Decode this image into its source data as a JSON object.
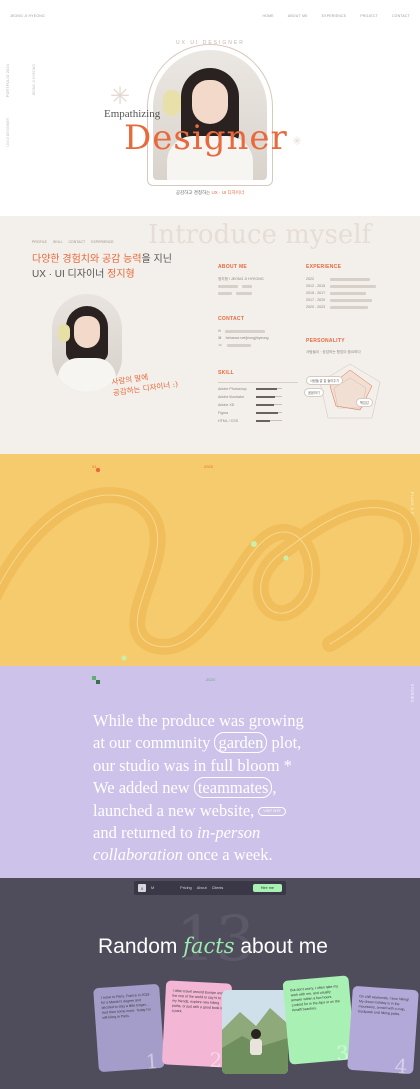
{
  "nav": {
    "brand": "JEONG JI HYEONG",
    "items": [
      "HOME",
      "ABOUT ME",
      "EXPERIENCE",
      "PROJECT",
      "CONTACT"
    ]
  },
  "hero": {
    "side_label_top": "PORTFOLIO 2024",
    "side_label_bottom": "UX/UI DESIGNER",
    "side_label_right": "JEONG JI HYEONG",
    "curve_text": "UX UI DESIGNER",
    "empath": "Empathizing",
    "designer": "Designer",
    "subtitle_prefix": "공감하고 경청하는",
    "subtitle_highlight": "UX · UI 디자이너"
  },
  "about": {
    "ghost": "Introduce myself",
    "crumbs": [
      "PROFILE",
      "SKILL",
      "CONTACT",
      "EXPERIENCE"
    ],
    "headline_1a": "다양한 경험치와 공감 능력",
    "headline_1b": "을 지닌",
    "headline_2a": "UX · UI 디자이너 ",
    "headline_2b": "정지형",
    "quote_line1": "사람의 말에",
    "quote_line2": "공감하는 디자이너 :)",
    "about_title": "ABOUT ME",
    "about_name": "정지형 / JEONG JI HYEONG",
    "contact_title": "CONTACT",
    "contact_email": "behance.net/jeongjihyeong",
    "skill_title": "SKILL",
    "skills": [
      {
        "name": "Adobe Photoshop",
        "level": 0.82
      },
      {
        "name": "Adobe Illustrator",
        "level": 0.74
      },
      {
        "name": "Adobe XD",
        "level": 0.7
      },
      {
        "name": "Figma",
        "level": 0.86
      },
      {
        "name": "HTML / CSS",
        "level": 0.55
      }
    ],
    "experience_title": "EXPERIENCE",
    "experience_years": [
      "2022",
      "2012 - 2015",
      "2015 - 2017",
      "2017 - 2020",
      "2020 - 2023"
    ],
    "personality_title": "PERSONALITY",
    "personality_sub": "사람들이 · 공감하는 협업이 중요하다",
    "personality_tags": [
      "사람들 말 잘 들어주기",
      "꼼꼼하기",
      "책임감"
    ]
  },
  "yellow": {
    "label_left": "01",
    "label_right": "2023",
    "side_label": "PLANS & STORIES"
  },
  "purple": {
    "year": "2023",
    "side_label": "STORIES",
    "line1": "While the produce was growing",
    "line2a": "at our community ",
    "pill_garden": "garden",
    "line2b": " plot,",
    "line3": "our studio was in full bloom *",
    "line4a": "We added new ",
    "pill_team": "teammates",
    "line4b": ",",
    "line5a": "launched a new website, ",
    "mini_pill": "VISIT SITE",
    "line6a": "and returned to ",
    "line6b": "in-person",
    "line7a": "collaboration",
    "line7b": " once a week."
  },
  "dark": {
    "nav_logo": "X",
    "nav_mark": "M",
    "nav_links": [
      "Pricing",
      "About",
      "Clients"
    ],
    "nav_cta": "Hire me",
    "big_number": "13",
    "title_a": "Random ",
    "title_b": "facts",
    "title_c": " about me",
    "cards": [
      {
        "text": "I move to Paris, France in 2019 for a Master's degree and decided to stay a little longer... And then some more. Today I'm still living in Paris.",
        "num": "1",
        "color": "#a49dc9"
      },
      {
        "text": "I often travel around Europe and the rest of the world to say hi to my friends, explore new hiking paths, or just with a good book in a park.",
        "num": "2",
        "color": "#f3b6d4"
      },
      {
        "text": "But don't worry, I often take my work with me, and usually answer within a few hours. Looked for in the Alps or on the Amalfi beaches.",
        "num": "3",
        "color": "#a8f0b4"
      },
      {
        "text": "On chill weekends, I love hiking! My dream holiday is in the mountains, armed with a map, backpack and hiking poles.",
        "num": "4",
        "color": "#b3a9d8"
      }
    ]
  },
  "colors": {
    "accent_orange": "#e8693c",
    "yellow_bg": "#f6cb6e",
    "purple_bg": "#cdc2e9",
    "dark_bg": "#4f4c5c",
    "mint": "#9cebb0"
  }
}
